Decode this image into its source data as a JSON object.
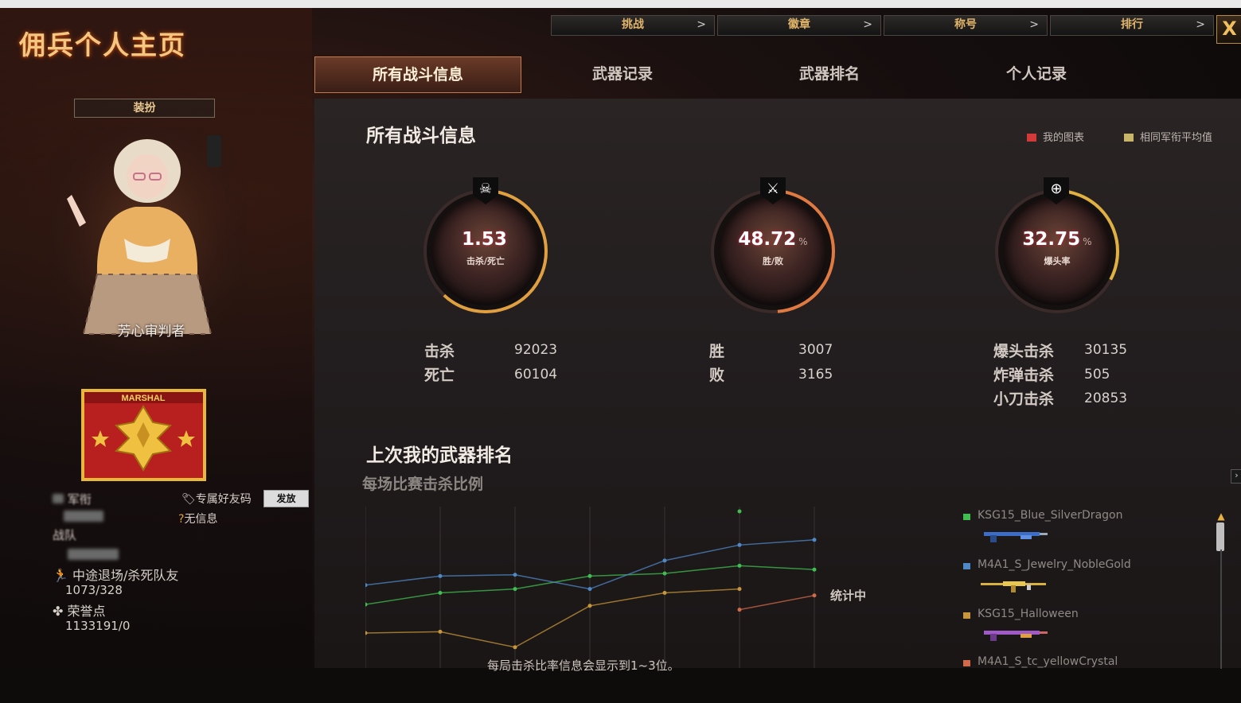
{
  "window": {
    "title": "佣兵个人主页",
    "close_label": "X"
  },
  "top_tabs": [
    {
      "label": "挑战",
      "chevron": ">"
    },
    {
      "label": "徽章",
      "chevron": ">"
    },
    {
      "label": "称号",
      "chevron": ">"
    },
    {
      "label": "排行",
      "chevron": ">"
    }
  ],
  "section_tabs": [
    {
      "label": "所有战斗信息",
      "active": true
    },
    {
      "label": "武器记录",
      "active": false
    },
    {
      "label": "武器排名",
      "active": false
    },
    {
      "label": "个人记录",
      "active": false
    }
  ],
  "sidebar": {
    "dress_button": "装扮",
    "nickname": "芳心审判者",
    "rank_badge": "MARSHAL",
    "military_rank_label": "军衔",
    "friend_code_label": "专属好友码",
    "send_button": "发放",
    "clan_label": "战队",
    "clan_value": "无信息",
    "quit_kill_label": "中途退场/杀死队友",
    "quit_kill_value": "1073/328",
    "honor_label": "荣誉点",
    "honor_value": "1133191/0"
  },
  "battle": {
    "heading": "所有战斗信息",
    "legend_mine": "我的图表",
    "legend_avg": "相同军衔平均值",
    "legend_colors": {
      "mine": "#d23a3a",
      "avg": "#c9b56a"
    },
    "rings": [
      {
        "value": "1.53",
        "unit": "",
        "caption": "击杀/死亡",
        "icon": "skull-icon",
        "fraction": 0.62
      },
      {
        "value": "48.72",
        "unit": "%",
        "caption": "胜/败",
        "icon": "crossed-guns-icon",
        "fraction": 0.4872
      },
      {
        "value": "32.75",
        "unit": "%",
        "caption": "爆头率",
        "icon": "crosshair-icon",
        "fraction": 0.3275
      }
    ],
    "stats": {
      "kills_label": "击杀",
      "kills": "92023",
      "deaths_label": "死亡",
      "deaths": "60104",
      "wins_label": "胜",
      "wins": "3007",
      "losses_label": "败",
      "losses": "3165",
      "headshot_label": "爆头击杀",
      "headshot": "30135",
      "bomb_label": "炸弹击杀",
      "bomb": "505",
      "knife_label": "小刀击杀",
      "knife": "20853"
    }
  },
  "weapon_rank": {
    "heading": "上次我的武器排名",
    "subheading": "每场比赛击杀比例",
    "pending": "统计中",
    "footnote": "每局击杀比率信息会显示到1~3位。",
    "weapons": [
      {
        "name": "KSG15_Blue_SilverDragon",
        "color": "#3fbf4f"
      },
      {
        "name": "M4A1_S_Jewelry_NobleGold",
        "color": "#4f88c8"
      },
      {
        "name": "KSG15_Halloween",
        "color": "#c8963a"
      },
      {
        "name": "M4A1_S_tc_yellowCrystal",
        "color": "#d06a4a"
      }
    ]
  },
  "chart_data": {
    "type": "line",
    "title": "每场比赛击杀比例",
    "x": [
      1,
      2,
      3,
      4,
      5,
      6,
      7
    ],
    "series": [
      {
        "name": "KSG15_Blue_SilverDragon",
        "color": "#3fbf4f",
        "values": [
          28,
          37,
          40,
          50,
          52,
          58,
          55
        ]
      },
      {
        "name": "M4A1_S_Jewelry_NobleGold",
        "color": "#4f88c8",
        "values": [
          43,
          50,
          51,
          40,
          62,
          74,
          78
        ]
      },
      {
        "name": "KSG15_Halloween",
        "color": "#c8963a",
        "values": [
          6,
          7,
          -5,
          27,
          37,
          40,
          null
        ]
      },
      {
        "name": "M4A1_S_tc_yellowCrystal",
        "color": "#d06a4a",
        "values": [
          null,
          null,
          null,
          null,
          null,
          24,
          35
        ]
      }
    ],
    "outlier_point": {
      "x": 6,
      "y": 100,
      "color": "#3fbf4f"
    },
    "ylim": [
      -10,
      100
    ],
    "grid": true
  }
}
